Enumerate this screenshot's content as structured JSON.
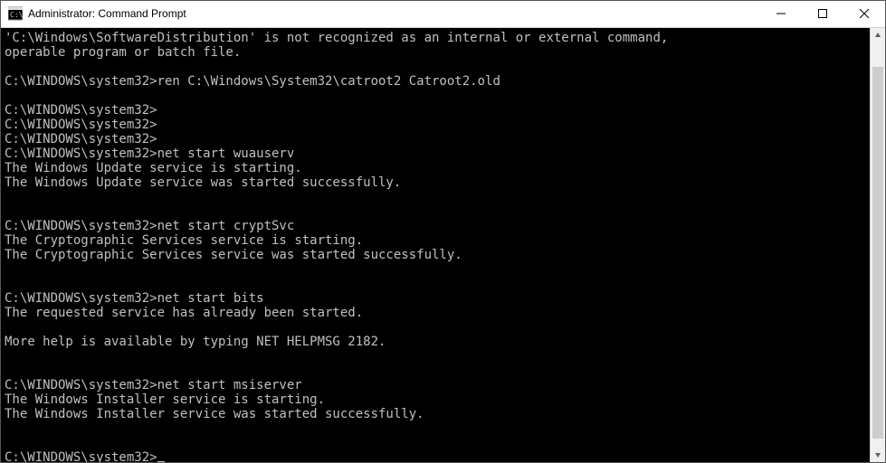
{
  "window": {
    "title": "Administrator: Command Prompt",
    "icon_name": "cmd-icon"
  },
  "scrollbar": {
    "thumb_top_pct": 6,
    "thumb_height_pct": 92
  },
  "terminal": {
    "prompt": "C:\\WINDOWS\\system32>",
    "lines": [
      {
        "type": "output",
        "text": "'C:\\Windows\\SoftwareDistribution' is not recognized as an internal or external command,"
      },
      {
        "type": "output",
        "text": "operable program or batch file."
      },
      {
        "type": "blank",
        "text": ""
      },
      {
        "type": "cmd",
        "prompt": "C:\\WINDOWS\\system32>",
        "command": "ren C:\\Windows\\System32\\catroot2 Catroot2.old"
      },
      {
        "type": "blank",
        "text": ""
      },
      {
        "type": "cmd",
        "prompt": "C:\\WINDOWS\\system32>",
        "command": ""
      },
      {
        "type": "cmd",
        "prompt": "C:\\WINDOWS\\system32>",
        "command": ""
      },
      {
        "type": "cmd",
        "prompt": "C:\\WINDOWS\\system32>",
        "command": ""
      },
      {
        "type": "cmd",
        "prompt": "C:\\WINDOWS\\system32>",
        "command": "net start wuauserv"
      },
      {
        "type": "output",
        "text": "The Windows Update service is starting."
      },
      {
        "type": "output",
        "text": "The Windows Update service was started successfully."
      },
      {
        "type": "blank",
        "text": ""
      },
      {
        "type": "blank",
        "text": ""
      },
      {
        "type": "cmd",
        "prompt": "C:\\WINDOWS\\system32>",
        "command": "net start cryptSvc"
      },
      {
        "type": "output",
        "text": "The Cryptographic Services service is starting."
      },
      {
        "type": "output",
        "text": "The Cryptographic Services service was started successfully."
      },
      {
        "type": "blank",
        "text": ""
      },
      {
        "type": "blank",
        "text": ""
      },
      {
        "type": "cmd",
        "prompt": "C:\\WINDOWS\\system32>",
        "command": "net start bits"
      },
      {
        "type": "output",
        "text": "The requested service has already been started."
      },
      {
        "type": "blank",
        "text": ""
      },
      {
        "type": "output",
        "text": "More help is available by typing NET HELPMSG 2182."
      },
      {
        "type": "blank",
        "text": ""
      },
      {
        "type": "blank",
        "text": ""
      },
      {
        "type": "cmd",
        "prompt": "C:\\WINDOWS\\system32>",
        "command": "net start msiserver"
      },
      {
        "type": "output",
        "text": "The Windows Installer service is starting."
      },
      {
        "type": "output",
        "text": "The Windows Installer service was started successfully."
      },
      {
        "type": "blank",
        "text": ""
      },
      {
        "type": "blank",
        "text": ""
      },
      {
        "type": "cursor",
        "prompt": "C:\\WINDOWS\\system32>",
        "command": ""
      }
    ]
  }
}
